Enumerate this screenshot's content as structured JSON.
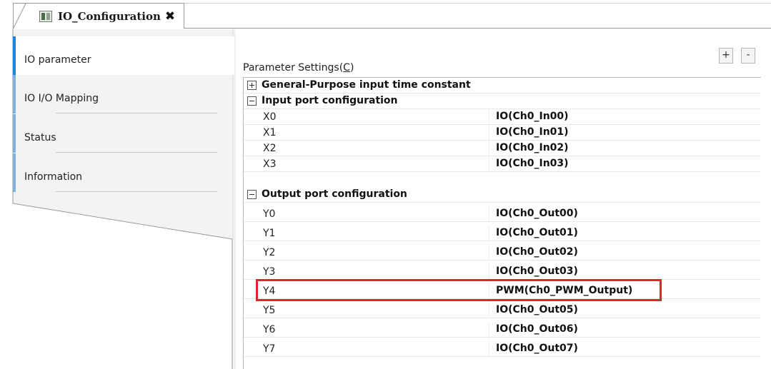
{
  "document_tab": {
    "title": "IO_Configuration",
    "close_glyph": "✖",
    "icon": "module-icon"
  },
  "sidebar": {
    "items": [
      {
        "label": "IO parameter",
        "active": true
      },
      {
        "label": "IO I/O Mapping",
        "active": false
      },
      {
        "label": "Status",
        "active": false
      },
      {
        "label": "Information",
        "active": false
      }
    ]
  },
  "parameter_settings": {
    "title_prefix": "Parameter Settings(",
    "title_hotkey": "C",
    "title_suffix": ")",
    "expand_all_label": "+",
    "collapse_all_label": "-"
  },
  "tree": {
    "general_purpose": {
      "label": "General-Purpose input time constant",
      "expander": "+"
    },
    "input_section": {
      "label": "Input port configuration",
      "expander": "-"
    },
    "inputs": [
      {
        "port": "X0",
        "value": "IO(Ch0_In00)"
      },
      {
        "port": "X1",
        "value": "IO(Ch0_In01)"
      },
      {
        "port": "X2",
        "value": "IO(Ch0_In02)"
      },
      {
        "port": "X3",
        "value": "IO(Ch0_In03)"
      }
    ],
    "output_section": {
      "label": "Output port configuration",
      "expander": "-"
    },
    "outputs": [
      {
        "port": "Y0",
        "value": "IO(Ch0_Out00)"
      },
      {
        "port": "Y1",
        "value": "IO(Ch0_Out01)"
      },
      {
        "port": "Y2",
        "value": "IO(Ch0_Out02)"
      },
      {
        "port": "Y3",
        "value": "IO(Ch0_Out03)"
      },
      {
        "port": "Y4",
        "value": "PWM(Ch0_PWM_Output)",
        "highlighted": true
      },
      {
        "port": "Y5",
        "value": "IO(Ch0_Out05)"
      },
      {
        "port": "Y6",
        "value": "IO(Ch0_Out06)"
      },
      {
        "port": "Y7",
        "value": "IO(Ch0_Out07)"
      }
    ]
  },
  "colors": {
    "highlight": "#e0242c",
    "nav_accent_active": "#1f86e0",
    "nav_accent": "#7fb1e0"
  }
}
